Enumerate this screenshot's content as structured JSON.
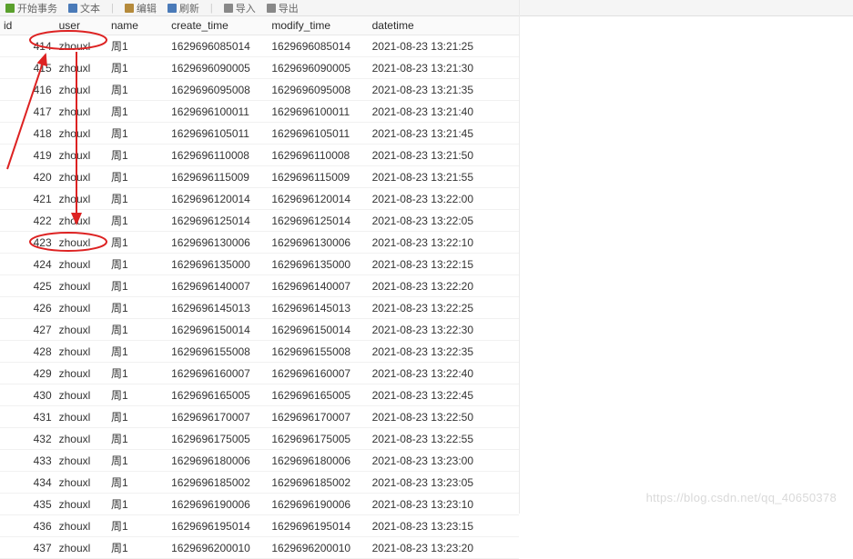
{
  "toolbar": {
    "btn1": "开始事务",
    "btn2": "文本",
    "btn3": "编辑",
    "btn4": "刷新",
    "btn5": "导入",
    "btn6": "导出"
  },
  "columns": {
    "id": "id",
    "user": "user",
    "name": "name",
    "create_time": "create_time",
    "modify_time": "modify_time",
    "datetime": "datetime"
  },
  "rows": [
    {
      "id": "414",
      "user": "zhouxl",
      "name": "周1",
      "create": "1629696085014",
      "modify": "1629696085014",
      "dt": "2021-08-23 13:21:25"
    },
    {
      "id": "415",
      "user": "zhouxl",
      "name": "周1",
      "create": "1629696090005",
      "modify": "1629696090005",
      "dt": "2021-08-23 13:21:30"
    },
    {
      "id": "416",
      "user": "zhouxl",
      "name": "周1",
      "create": "1629696095008",
      "modify": "1629696095008",
      "dt": "2021-08-23 13:21:35"
    },
    {
      "id": "417",
      "user": "zhouxl",
      "name": "周1",
      "create": "1629696100011",
      "modify": "1629696100011",
      "dt": "2021-08-23 13:21:40"
    },
    {
      "id": "418",
      "user": "zhouxl",
      "name": "周1",
      "create": "1629696105011",
      "modify": "1629696105011",
      "dt": "2021-08-23 13:21:45"
    },
    {
      "id": "419",
      "user": "zhouxl",
      "name": "周1",
      "create": "1629696110008",
      "modify": "1629696110008",
      "dt": "2021-08-23 13:21:50"
    },
    {
      "id": "420",
      "user": "zhouxl",
      "name": "周1",
      "create": "1629696115009",
      "modify": "1629696115009",
      "dt": "2021-08-23 13:21:55"
    },
    {
      "id": "421",
      "user": "zhouxl",
      "name": "周1",
      "create": "1629696120014",
      "modify": "1629696120014",
      "dt": "2021-08-23 13:22:00"
    },
    {
      "id": "422",
      "user": "zhouxl",
      "name": "周1",
      "create": "1629696125014",
      "modify": "1629696125014",
      "dt": "2021-08-23 13:22:05"
    },
    {
      "id": "423",
      "user": "zhouxl",
      "name": "周1",
      "create": "1629696130006",
      "modify": "1629696130006",
      "dt": "2021-08-23 13:22:10"
    },
    {
      "id": "424",
      "user": "zhouxl",
      "name": "周1",
      "create": "1629696135000",
      "modify": "1629696135000",
      "dt": "2021-08-23 13:22:15"
    },
    {
      "id": "425",
      "user": "zhouxl",
      "name": "周1",
      "create": "1629696140007",
      "modify": "1629696140007",
      "dt": "2021-08-23 13:22:20"
    },
    {
      "id": "426",
      "user": "zhouxl",
      "name": "周1",
      "create": "1629696145013",
      "modify": "1629696145013",
      "dt": "2021-08-23 13:22:25"
    },
    {
      "id": "427",
      "user": "zhouxl",
      "name": "周1",
      "create": "1629696150014",
      "modify": "1629696150014",
      "dt": "2021-08-23 13:22:30"
    },
    {
      "id": "428",
      "user": "zhouxl",
      "name": "周1",
      "create": "1629696155008",
      "modify": "1629696155008",
      "dt": "2021-08-23 13:22:35"
    },
    {
      "id": "429",
      "user": "zhouxl",
      "name": "周1",
      "create": "1629696160007",
      "modify": "1629696160007",
      "dt": "2021-08-23 13:22:40"
    },
    {
      "id": "430",
      "user": "zhouxl",
      "name": "周1",
      "create": "1629696165005",
      "modify": "1629696165005",
      "dt": "2021-08-23 13:22:45"
    },
    {
      "id": "431",
      "user": "zhouxl",
      "name": "周1",
      "create": "1629696170007",
      "modify": "1629696170007",
      "dt": "2021-08-23 13:22:50"
    },
    {
      "id": "432",
      "user": "zhouxl",
      "name": "周1",
      "create": "1629696175005",
      "modify": "1629696175005",
      "dt": "2021-08-23 13:22:55"
    },
    {
      "id": "433",
      "user": "zhouxl",
      "name": "周1",
      "create": "1629696180006",
      "modify": "1629696180006",
      "dt": "2021-08-23 13:23:00"
    },
    {
      "id": "434",
      "user": "zhouxl",
      "name": "周1",
      "create": "1629696185002",
      "modify": "1629696185002",
      "dt": "2021-08-23 13:23:05"
    },
    {
      "id": "435",
      "user": "zhouxl",
      "name": "周1",
      "create": "1629696190006",
      "modify": "1629696190006",
      "dt": "2021-08-23 13:23:10"
    },
    {
      "id": "436",
      "user": "zhouxl",
      "name": "周1",
      "create": "1629696195014",
      "modify": "1629696195014",
      "dt": "2021-08-23 13:23:15"
    },
    {
      "id": "437",
      "user": "zhouxl",
      "name": "周1",
      "create": "1629696200010",
      "modify": "1629696200010",
      "dt": "2021-08-23 13:23:20"
    }
  ],
  "annotation": {
    "ellipse_color": "#d22",
    "arrow_color": "#d22"
  },
  "watermark": "https://blog.csdn.net/qq_40650378"
}
